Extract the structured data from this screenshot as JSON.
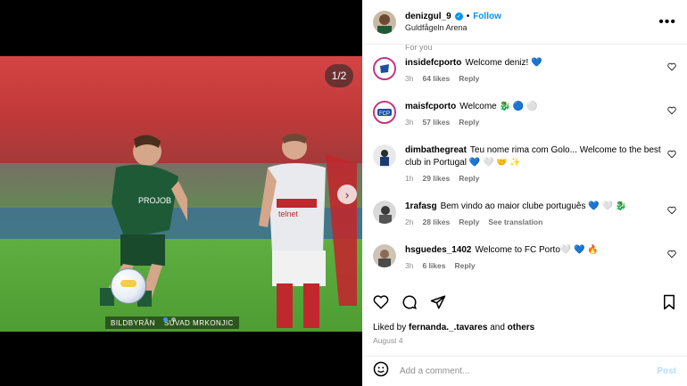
{
  "post": {
    "username": "denizgul_9",
    "follow_label": "Follow",
    "location": "Guldfågeln Arena",
    "counter": "1/2",
    "watermark_left": "BILDBYRÅN",
    "watermark_right": "SUVAD MRKONJIC"
  },
  "comments_header_fade": "For you",
  "comments": [
    {
      "user": "insidefcporto",
      "text": "Welcome deniz! 💙",
      "time": "3h",
      "likes": "64 likes",
      "reply": "Reply",
      "translate": ""
    },
    {
      "user": "maisfcporto",
      "text": "Welcome 🐉 🔵 ⚪",
      "time": "3h",
      "likes": "57 likes",
      "reply": "Reply",
      "translate": ""
    },
    {
      "user": "dimbathegreat",
      "text": "Teu nome rima com Golo... Welcome to the best club in Portugal 💙 🤍 🤝 ✨",
      "time": "1h",
      "likes": "29 likes",
      "reply": "Reply",
      "translate": ""
    },
    {
      "user": "1rafasg",
      "text": "Bem vindo ao maior clube português 💙 🤍 🐉",
      "time": "2h",
      "likes": "28 likes",
      "reply": "Reply",
      "translate": "See translation"
    },
    {
      "user": "hsguedes_1402",
      "text": "Welcome to FC Porto🤍 💙 🔥",
      "time": "3h",
      "likes": "6 likes",
      "reply": "Reply",
      "translate": ""
    }
  ],
  "likes_prefix": "Liked by",
  "likes_user": "fernanda._.tavares",
  "likes_and": "and",
  "likes_others": "others",
  "date": "August 4",
  "add_comment_placeholder": "Add a comment...",
  "post_label": "Post",
  "colors": {
    "accent": "#0095f6",
    "verified": "#0095f6",
    "muted": "#8e8e8e"
  }
}
